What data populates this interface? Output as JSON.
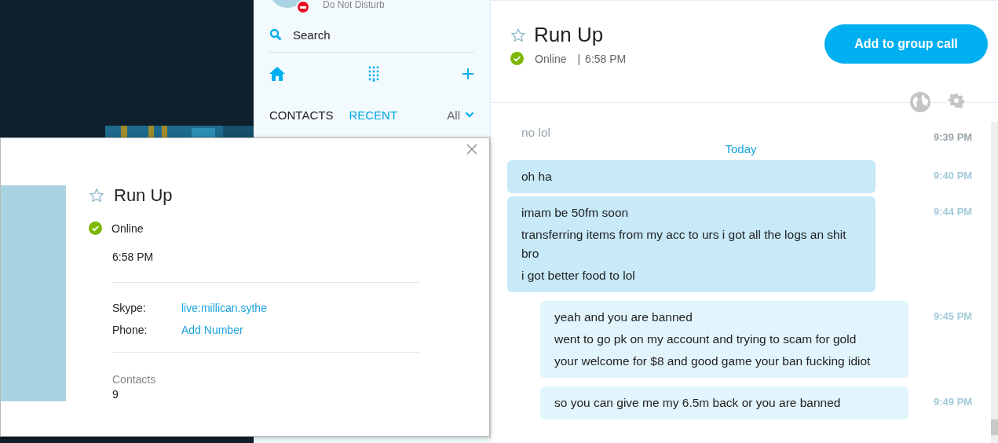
{
  "profile": {
    "status": "Do Not Disturb"
  },
  "search": {
    "placeholder": "Search"
  },
  "tabs": [
    {
      "label": "CONTACTS",
      "selected": false
    },
    {
      "label": "RECENT",
      "selected": true
    }
  ],
  "filter": {
    "label": "All"
  },
  "chat": {
    "title": "Run Up",
    "presence_label": "Online",
    "separator": "|",
    "local_time": "6:58 PM",
    "call_button": "Add to group call",
    "day_label": "Today",
    "messages": [
      {
        "kind": "faded",
        "lines": [
          "no lol"
        ],
        "time": "9:39 PM"
      },
      {
        "kind": "incoming",
        "lines": [
          "oh ha"
        ],
        "time": "9:40 PM"
      },
      {
        "kind": "incoming",
        "lines": [
          "imam be 50fm soon",
          "transferring items from my acc to urs i got all the logs an shit bro",
          "i got better food to lol"
        ],
        "time": "9:44 PM"
      },
      {
        "kind": "outgoing",
        "lines": [
          "yeah and you are banned",
          "went to go pk on my account and trying to scam for gold",
          "your welcome for $8 and good game your ban fucking idiot"
        ],
        "time": "9:45 PM"
      },
      {
        "kind": "outgoing",
        "lines": [
          "so you can give me my 6.5m back or you are banned"
        ],
        "time": "9:49 PM"
      }
    ]
  },
  "contact_card": {
    "name": "Run Up",
    "presence_label": "Online",
    "local_time": "6:58 PM",
    "fields": [
      {
        "label": "Skype:",
        "value": "live:millican.sythe"
      },
      {
        "label": "Phone:",
        "value": "Add Number"
      }
    ],
    "contacts_label": "Contacts",
    "contacts_count": "9"
  }
}
